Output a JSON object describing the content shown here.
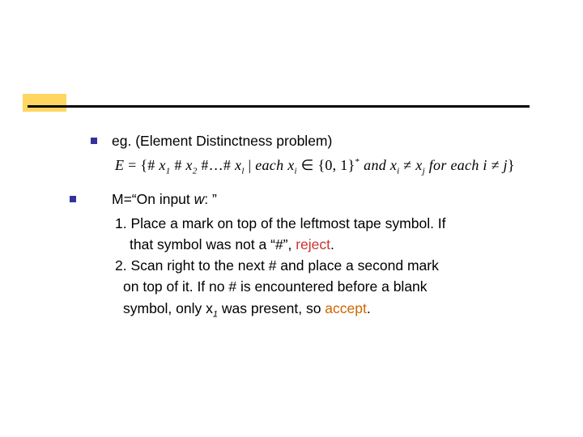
{
  "bullets": {
    "b1": "eg. (Element Distinctness problem)",
    "b2_prefix": "M=“On input ",
    "b2_var": "w",
    "b2_suffix": ": ”"
  },
  "formula": {
    "E_eq": "E",
    "eq": " = ",
    "open": "{# ",
    "x": "x",
    "hash": " # ",
    "dots": " #…# ",
    "bar": " | ",
    "each": "each ",
    "in": " ∈ ",
    "set": "{0, 1}",
    "star": "*",
    "and": " and ",
    "neq": " ≠ ",
    "foreach": " for each ",
    "ineqj": "i ≠ j",
    "close": "}",
    "s1": "1",
    "s2": "2",
    "sl": "l",
    "si": "i",
    "sj": "j"
  },
  "steps": {
    "l1": "1. Place a mark on top of the leftmost tape symbol. If",
    "l2a": "that symbol was not a “#”, ",
    "l2_reject": "reject",
    "l2b": ".",
    "l3": "2. Scan right to the next # and place a second mark",
    "l4": "on top of it. If no # is encountered before a blank",
    "l5a": "symbol, only ",
    "l5_var": "x",
    "l5_sub": "1",
    "l5b": " was present, so ",
    "l5_accept": "accept",
    "l5c": "."
  }
}
